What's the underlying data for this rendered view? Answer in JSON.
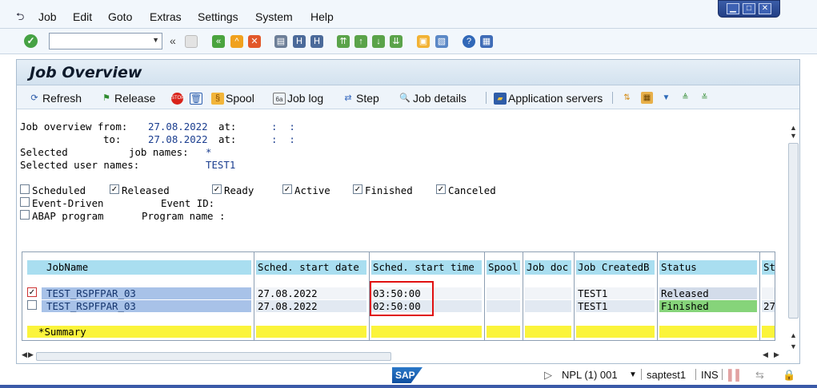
{
  "menubar": {
    "icon": "menu-arrow-icon",
    "items": [
      "Job",
      "Edit",
      "Goto",
      "Extras",
      "Settings",
      "System",
      "Help"
    ]
  },
  "window_controls": {
    "minimize": "▁",
    "maximize": "□",
    "close": "✕"
  },
  "std_toolbar": {
    "command_field": {
      "value": "",
      "placeholder": ""
    },
    "back_glyph": "«"
  },
  "title": "Job Overview",
  "app_toolbar": {
    "refresh": "Refresh",
    "release": "Release",
    "stop_icon_text": "STOP",
    "spool": "Spool",
    "job_log": "Job log",
    "step": "Step",
    "job_details": "Job details",
    "application_servers": "Application servers"
  },
  "criteria": {
    "from_label": "Job overview from:",
    "from_date": "27.08.2022",
    "at_label": "at:",
    "from_time": ":  :",
    "to_label": "to:",
    "to_date": "27.08.2022",
    "to_time": ":  :",
    "selected_label": "Selected",
    "job_names_label": "job names:",
    "job_names_value": "*",
    "user_names_label": "Selected user names:",
    "user_names_value": "TEST1"
  },
  "status_checkboxes": [
    {
      "label": "Scheduled",
      "checked": false
    },
    {
      "label": "Released",
      "checked": true
    },
    {
      "label": "Ready",
      "checked": true
    },
    {
      "label": "Active",
      "checked": true
    },
    {
      "label": "Finished",
      "checked": true
    },
    {
      "label": "Canceled",
      "checked": true
    }
  ],
  "event_driven": {
    "label": "Event-Driven",
    "checked": false,
    "event_id_label": "Event ID:"
  },
  "abap_program": {
    "label": "ABAP program",
    "checked": false,
    "program_name_label": "Program name :"
  },
  "table": {
    "headers": [
      "JobName",
      "Sched. start date",
      "Sched. start time",
      "Spool",
      "Job doc",
      "Job CreatedB",
      "Status",
      "St"
    ],
    "rows": [
      {
        "selected": true,
        "job_name": "TEST_RSPFPAR_03",
        "date": "27.08.2022",
        "time": "03:50:00",
        "spool": "",
        "job_doc": "",
        "created_by": "TEST1",
        "status": "Released",
        "status_color": "#d3dcea",
        "extra": ""
      },
      {
        "selected": false,
        "job_name": "TEST_RSPFPAR_03",
        "date": "27.08.2022",
        "time": "02:50:00",
        "spool": "spool-icon",
        "job_doc": "",
        "created_by": "TEST1",
        "status": "Finished",
        "status_color": "#86d47a",
        "extra": "27"
      }
    ],
    "summary_label": "*Summary"
  },
  "statusbar": {
    "logo": "SAP",
    "system": "NPL (1) 001",
    "user": "saptest1",
    "mode": "INS"
  },
  "colors": {
    "header_cell": "#a9def0",
    "jobname_cell": "#a8c2e8",
    "summary_row": "#fbf43b",
    "highlight": "#e01010"
  }
}
